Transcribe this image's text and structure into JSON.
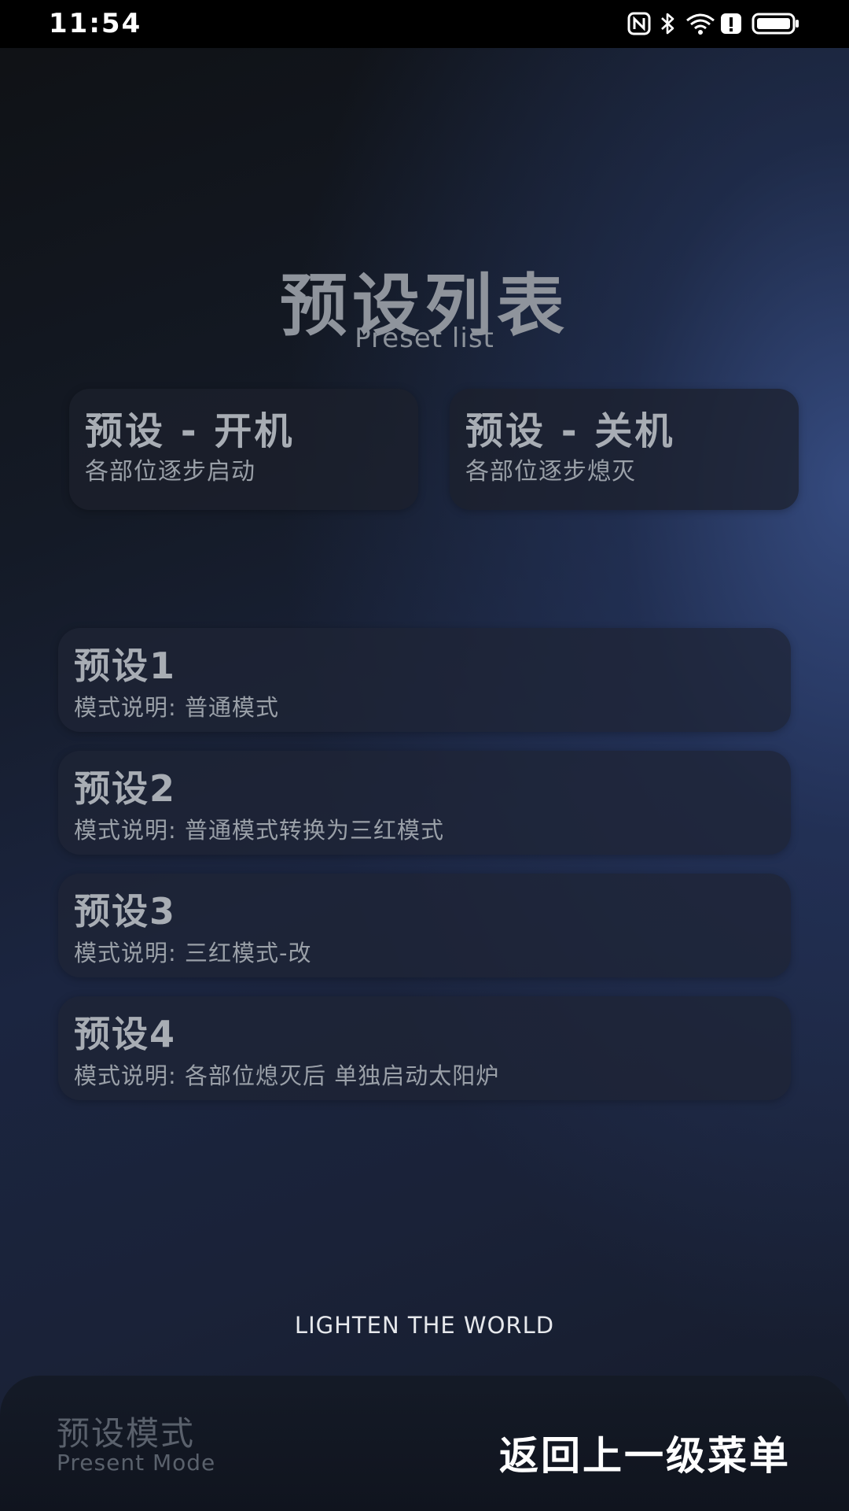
{
  "status_bar": {
    "time": "11:54",
    "icons": [
      "nfc-icon",
      "bluetooth-icon",
      "wifi-icon",
      "alert-icon",
      "battery-icon"
    ]
  },
  "header": {
    "title": "预设列表",
    "subtitle": "Preset list"
  },
  "top_cards": [
    {
      "title": "预设 - 开机",
      "subtitle": "各部位逐步启动"
    },
    {
      "title": "预设 - 关机",
      "subtitle": "各部位逐步熄灭"
    }
  ],
  "presets": [
    {
      "title": "预设1",
      "desc": "模式说明:  普通模式"
    },
    {
      "title": "预设2",
      "desc": "模式说明:  普通模式转换为三红模式"
    },
    {
      "title": "预设3",
      "desc": "模式说明:  三红模式-改"
    },
    {
      "title": "预设4",
      "desc": "模式说明:  各部位熄灭后 单独启动太阳炉"
    }
  ],
  "slogan": "LIGHTEN THE WORLD",
  "bottom_bar": {
    "mode_cn": "预设模式",
    "mode_en": "Present Mode",
    "back_label": "返回上一级菜单"
  }
}
